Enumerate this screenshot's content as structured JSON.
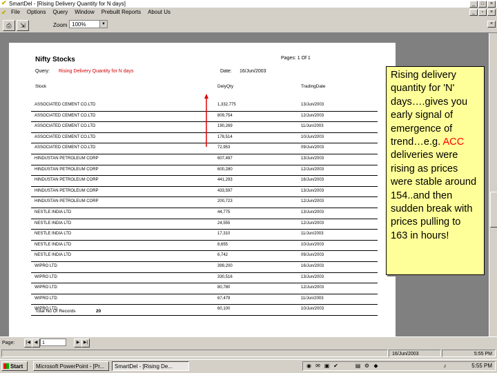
{
  "window": {
    "title": "SmartDel - [Rising Delivery Quantity for N days]",
    "menu": [
      "File",
      "Options",
      "Query",
      "Window",
      "Prebuilt Reports",
      "About Us"
    ]
  },
  "toolbar": {
    "print_icon": "printer-icon",
    "export_icon": "export-icon",
    "zoom_label": "Zoom",
    "zoom_value": "100%"
  },
  "report": {
    "title": "Nifty Stocks",
    "pages_label": "Pages:  1  Of  1",
    "criteria_label": "Query:",
    "criteria_value": "Rising Delivery Quantity for N days",
    "date_label": "Date:",
    "date_value": "16/Jun/2003",
    "columns": [
      "Stock",
      "DelyQty",
      "TradingDate"
    ],
    "rows": [
      [
        "ASSOCIATED CEMENT CO.LTD",
        "1,332,775",
        "13/Jun/2003"
      ],
      [
        "ASSOCIATED CEMENT CO.LTD",
        "809,754",
        "12/Jun/2003"
      ],
      [
        "ASSOCIATED CEMENT CO.LTD",
        "190,269",
        "11/Jun/2003"
      ],
      [
        "ASSOCIATED CEMENT CO.LTD",
        "178,514",
        "10/Jun/2003"
      ],
      [
        "ASSOCIATED CEMENT CO.LTD",
        "72,953",
        "09/Jun/2003"
      ],
      [
        "HINDUSTAN PETROLEUM CORP",
        "607,497",
        "13/Jun/2003"
      ],
      [
        "HINDUSTAN PETROLEUM CORP",
        "600,280",
        "12/Jun/2003"
      ],
      [
        "HINDUSTAN PETROLEUM CORP",
        "441,293",
        "16/Jun/2003"
      ],
      [
        "HINDUSTAN PETROLEUM CORP",
        "433,597",
        "13/Jun/2003"
      ],
      [
        "HINDUSTAN PETROLEUM CORP",
        "200,723",
        "12/Jun/2003"
      ],
      [
        "NESTLE INDIA LTD",
        "44,775",
        "13/Jun/2003"
      ],
      [
        "NESTLE INDIA LTD",
        "24,555",
        "12/Jun/2003"
      ],
      [
        "NESTLE INDIA LTD",
        "17,310",
        "11/Jun/2003"
      ],
      [
        "NESTLE INDIA LTD",
        "8,655",
        "10/Jun/2003"
      ],
      [
        "NESTLE INDIA LTD",
        "6,742",
        "09/Jun/2003"
      ],
      [
        "WIPRO LTD",
        "399,200",
        "16/Jun/2003"
      ],
      [
        "WIPRO LTD",
        "330,516",
        "13/Jun/2003"
      ],
      [
        "WIPRO LTD",
        "80,780",
        "12/Jun/2003"
      ],
      [
        "WIPRO LTD",
        "67,479",
        "11/Jun/2003"
      ],
      [
        "WIPRO LTD",
        "60,100",
        "10/Jun/2003"
      ]
    ],
    "total_label": "Total No Of Records",
    "total_value": "20"
  },
  "callout": {
    "text_before": "Rising delivery quantity for 'N' days….gives you early signal of emergence of trend…e.g. ",
    "highlight": "ACC",
    "text_after": " deliveries were rising as prices were stable around 154..and then sudden break with prices pulling to 163 in hours!",
    "highlight_color": "#ff0000"
  },
  "pager": {
    "label": "Page:",
    "page_value": "1"
  },
  "statusbar": {
    "date": "16/Jun/2003",
    "time": "5:55 PM"
  },
  "taskbar": {
    "start_label": "Start",
    "tasks": [
      "Microsoft PowerPoint - [Pr...",
      "SmartDel - [Rising De..."
    ],
    "clock": "5:55 PM"
  }
}
